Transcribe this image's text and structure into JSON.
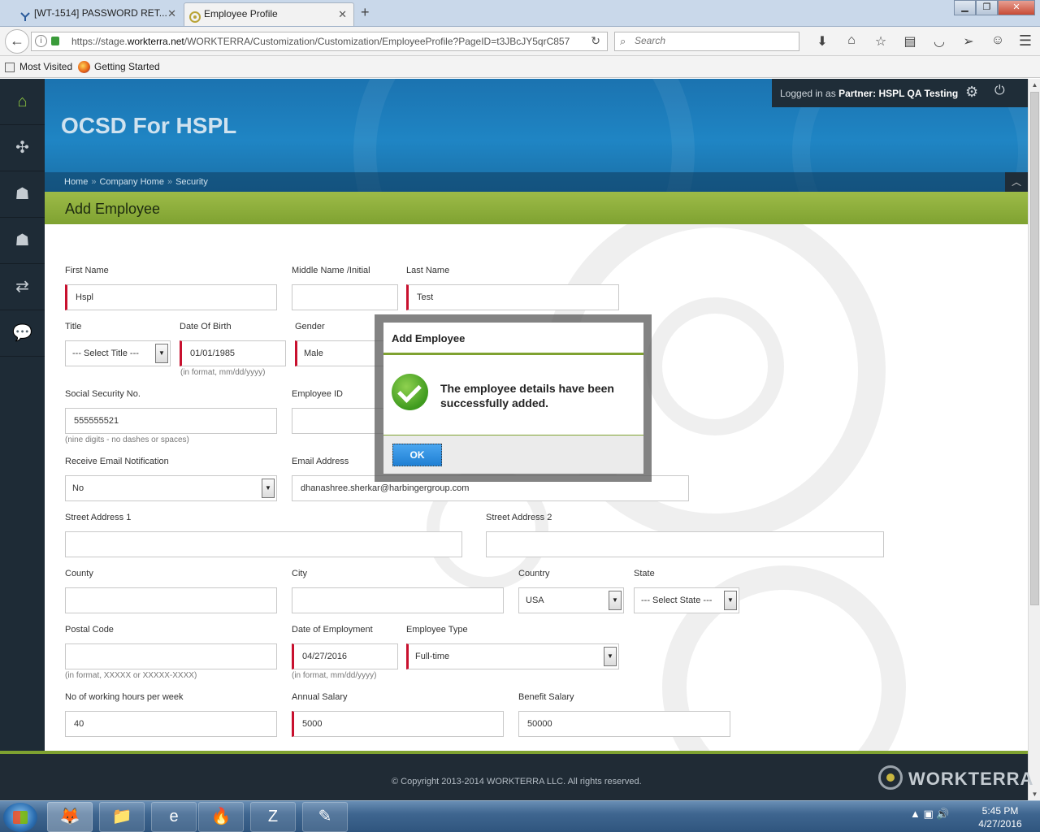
{
  "browser": {
    "tabs": [
      {
        "label": "[WT-1514] PASSWORD RET..."
      },
      {
        "label": "Employee Profile"
      }
    ],
    "url_prefix": "https://stage.",
    "url_domain": "workterra.net",
    "url_path": "/WORKTERRA/Customization/Customization/EmployeeProfile?PageID=t3JBcJY5qrC857",
    "search_placeholder": "Search",
    "bookmarks": [
      "Most Visited",
      "Getting Started"
    ]
  },
  "header": {
    "company": "OCSD For HSPL",
    "logged_prefix": "Logged in as",
    "logged_role": "Partner:",
    "logged_user": "HSPL QA Testing",
    "breadcrumb": [
      "Home",
      "Company Home",
      "Security"
    ]
  },
  "page": {
    "title": "Add Employee"
  },
  "form": {
    "first_name": {
      "label": "First Name",
      "value": "Hspl"
    },
    "middle_name": {
      "label": "Middle Name /Initial",
      "value": ""
    },
    "last_name": {
      "label": "Last Name",
      "value": "Test"
    },
    "title": {
      "label": "Title",
      "value": "--- Select Title ---"
    },
    "dob": {
      "label": "Date Of Birth",
      "value": "01/01/1985",
      "hint": "(in format, mm/dd/yyyy)"
    },
    "gender": {
      "label": "Gender",
      "value": "Male"
    },
    "ssn": {
      "label": "Social Security No.",
      "value": "555555521",
      "hint": "(nine digits - no dashes or spaces)"
    },
    "employee_id": {
      "label": "Employee ID",
      "value": ""
    },
    "email_notify": {
      "label": "Receive Email Notification",
      "value": "No"
    },
    "email": {
      "label": "Email Address",
      "value": "dhanashree.sherkar@harbingergroup.com"
    },
    "street1": {
      "label": "Street Address 1",
      "value": ""
    },
    "street2": {
      "label": "Street Address 2",
      "value": ""
    },
    "county": {
      "label": "County",
      "value": ""
    },
    "city": {
      "label": "City",
      "value": ""
    },
    "country": {
      "label": "Country",
      "value": "USA"
    },
    "state": {
      "label": "State",
      "value": "--- Select State ---"
    },
    "postal": {
      "label": "Postal Code",
      "value": "",
      "hint": "(in format, XXXXX or XXXXX-XXXX)"
    },
    "doe": {
      "label": "Date of Employment",
      "value": "04/27/2016",
      "hint": "(in format, mm/dd/yyyy)"
    },
    "emp_type": {
      "label": "Employee Type",
      "value": "Full-time"
    },
    "hours": {
      "label": "No of working hours per week",
      "value": "40"
    },
    "salary": {
      "label": "Annual Salary",
      "value": "5000"
    },
    "benefit_salary": {
      "label": "Benefit Salary",
      "value": "50000"
    }
  },
  "modal": {
    "title": "Add Employee",
    "message": "The employee details have been successfully added.",
    "ok_label": "OK"
  },
  "footer": {
    "copyright": "© Copyright 2013-2014 WORKTERRA LLC. All rights reserved.",
    "brand": "WORKTERRA"
  },
  "taskbar": {
    "time": "5:45 PM",
    "date": "4/27/2016"
  }
}
